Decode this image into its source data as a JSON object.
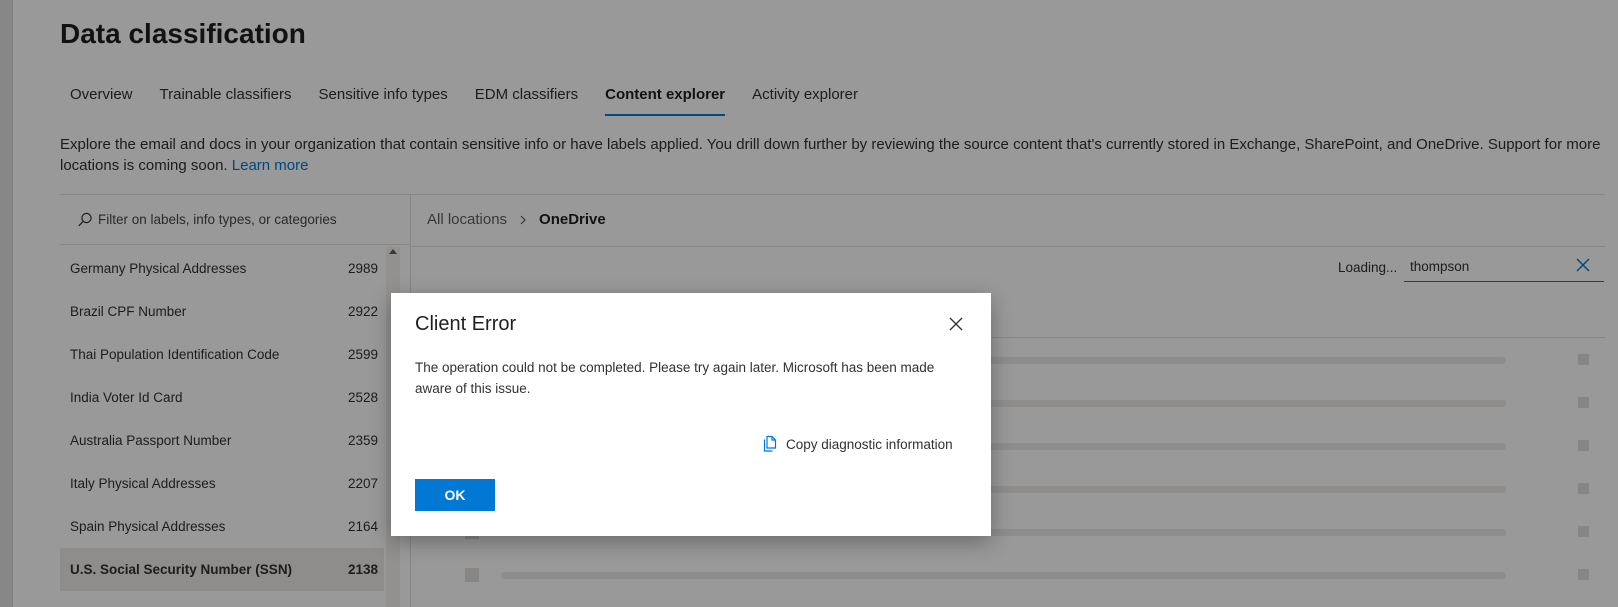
{
  "page": {
    "title": "Data classification",
    "tabs": [
      {
        "label": "Overview",
        "active": false
      },
      {
        "label": "Trainable classifiers",
        "active": false
      },
      {
        "label": "Sensitive info types",
        "active": false
      },
      {
        "label": "EDM classifiers",
        "active": false
      },
      {
        "label": "Content explorer",
        "active": true
      },
      {
        "label": "Activity explorer",
        "active": false
      }
    ],
    "description": "Explore the email and docs in your organization that contain sensitive info or have labels applied. You drill down further by reviewing the source content that's currently stored in Exchange, SharePoint, and OneDrive. Support for more locations is coming soon.",
    "learn_more": "Learn more"
  },
  "left_panel": {
    "filter_placeholder": "Filter on labels, info types, or categories",
    "items": [
      {
        "label": "Germany Physical Addresses",
        "count": "2989",
        "selected": false
      },
      {
        "label": "Brazil CPF Number",
        "count": "2922",
        "selected": false
      },
      {
        "label": "Thai Population Identification Code",
        "count": "2599",
        "selected": false
      },
      {
        "label": "India Voter Id Card",
        "count": "2528",
        "selected": false
      },
      {
        "label": "Australia Passport Number",
        "count": "2359",
        "selected": false
      },
      {
        "label": "Italy Physical Addresses",
        "count": "2207",
        "selected": false
      },
      {
        "label": "Spain Physical Addresses",
        "count": "2164",
        "selected": false
      },
      {
        "label": "U.S. Social Security Number (SSN)",
        "count": "2138",
        "selected": true
      }
    ]
  },
  "right_panel": {
    "breadcrumb": {
      "root": "All locations",
      "current": "OneDrive"
    },
    "loading_text": "Loading...",
    "search_value": "thompson"
  },
  "dialog": {
    "title": "Client Error",
    "message": "The operation could not be completed. Please try again later. Microsoft has been made aware of this issue.",
    "copy_label": "Copy diagnostic information",
    "ok_label": "OK"
  },
  "colors": {
    "accent": "#0078d4",
    "overlay": "rgba(0,0,0,0.40)"
  }
}
